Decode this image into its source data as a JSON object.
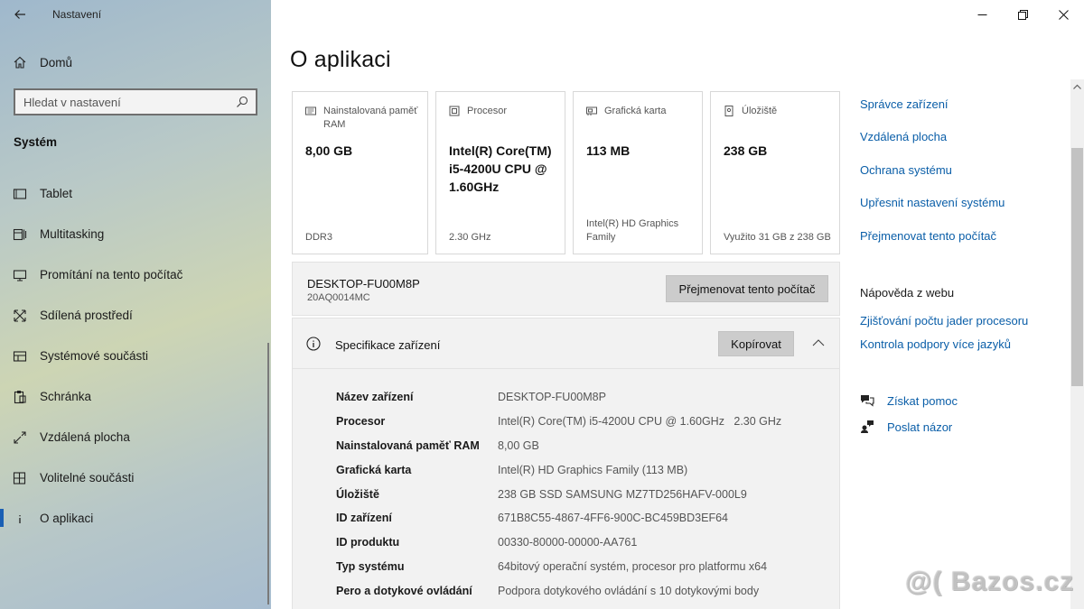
{
  "window": {
    "title": "Nastavení"
  },
  "sidebar": {
    "home": "Domů",
    "search_placeholder": "Hledat v nastavení",
    "section": "Systém",
    "items": [
      {
        "label": "Tablet",
        "icon": "tablet-icon"
      },
      {
        "label": "Multitasking",
        "icon": "multitasking-icon"
      },
      {
        "label": "Promítání na tento počítač",
        "icon": "projecting-icon"
      },
      {
        "label": "Sdílená prostředí",
        "icon": "shared-experiences-icon"
      },
      {
        "label": "Systémové součásti",
        "icon": "system-components-icon"
      },
      {
        "label": "Schránka",
        "icon": "clipboard-icon"
      },
      {
        "label": "Vzdálená plocha",
        "icon": "remote-desktop-icon"
      },
      {
        "label": "Volitelné součásti",
        "icon": "optional-features-icon"
      },
      {
        "label": "O aplikaci",
        "icon": "info-icon",
        "active": true
      }
    ]
  },
  "main": {
    "title": "O aplikaci",
    "cards": [
      {
        "title": "Nainstalovaná paměť RAM",
        "value": "8,00 GB",
        "footer": "DDR3",
        "icon": "memory-icon"
      },
      {
        "title": "Procesor",
        "value": "Intel(R) Core(TM) i5-4200U CPU @ 1.60GHz",
        "footer": "2.30 GHz",
        "icon": "processor-icon"
      },
      {
        "title": "Grafická karta",
        "value": "113 MB",
        "footer": "Intel(R) HD Graphics Family",
        "icon": "graphics-icon"
      },
      {
        "title": "Úložiště",
        "value": "238 GB",
        "footer": "Využito 31 GB z 238 GB",
        "icon": "storage-icon"
      }
    ],
    "pc_name": "DESKTOP-FU00M8P",
    "pc_model": "20AQ0014MC",
    "rename_button": "Přejmenovat tento počítač",
    "specs": {
      "title": "Specifikace zařízení",
      "copy_button": "Kopírovat",
      "rows": [
        {
          "key": "Název zařízení",
          "value": "DESKTOP-FU00M8P"
        },
        {
          "key": "Procesor",
          "value": "Intel(R) Core(TM) i5-4200U CPU @ 1.60GHz   2.30 GHz"
        },
        {
          "key": "Nainstalovaná paměť RAM",
          "value": "8,00 GB"
        },
        {
          "key": "Grafická karta",
          "value": "Intel(R) HD Graphics Family (113 MB)"
        },
        {
          "key": "Úložiště",
          "value": "238 GB SSD SAMSUNG MZ7TD256HAFV-000L9"
        },
        {
          "key": "ID zařízení",
          "value": "671B8C55-4867-4FF6-900C-BC459BD3EF64"
        },
        {
          "key": "ID produktu",
          "value": "00330-80000-00000-AA761"
        },
        {
          "key": "Typ systému",
          "value": "64bitový operační systém, procesor pro platformu x64"
        },
        {
          "key": "Pero a dotykové ovládání",
          "value": "Podpora dotykového ovládání s 10 dotykovými body"
        }
      ]
    }
  },
  "related": {
    "links": [
      "Správce zařízení",
      "Vzdálená plocha",
      "Ochrana systému",
      "Upřesnit nastavení systému",
      "Přejmenovat tento počítač"
    ],
    "web_title": "Nápověda z webu",
    "web_links": [
      "Zjišťování počtu jader procesoru",
      "Kontrola podpory více jazyků"
    ],
    "help": "Získat pomoc",
    "feedback": "Poslat názor"
  },
  "watermark": "@( Bazos.cz"
}
